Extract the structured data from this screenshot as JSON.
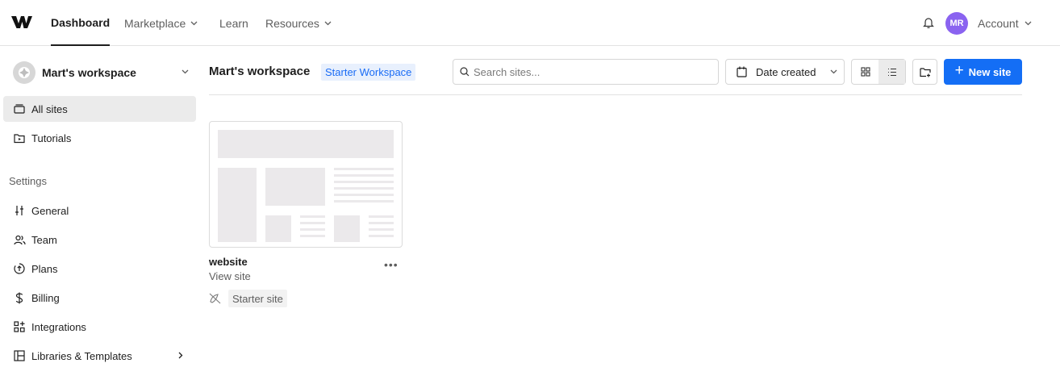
{
  "nav": {
    "items": [
      {
        "label": "Dashboard"
      },
      {
        "label": "Marketplace"
      },
      {
        "label": "Learn"
      },
      {
        "label": "Resources"
      }
    ],
    "avatar_initials": "MR",
    "account_label": "Account"
  },
  "sidebar": {
    "workspace_name": "Mart's workspace",
    "items": [
      {
        "label": "All sites",
        "icon": "folder-icon"
      },
      {
        "label": "Tutorials",
        "icon": "tutorial-icon"
      }
    ],
    "settings_heading": "Settings",
    "settings_items": [
      {
        "label": "General",
        "icon": "sliders-icon"
      },
      {
        "label": "Team",
        "icon": "team-icon"
      },
      {
        "label": "Plans",
        "icon": "plans-icon"
      },
      {
        "label": "Billing",
        "icon": "dollar-icon"
      },
      {
        "label": "Integrations",
        "icon": "integrations-icon"
      },
      {
        "label": "Libraries & Templates",
        "icon": "library-icon"
      }
    ]
  },
  "main": {
    "title": "Mart's workspace",
    "badge": "Starter Workspace",
    "search_placeholder": "Search sites...",
    "sort_label": "Date created",
    "new_site_label": "New site",
    "sites": [
      {
        "name": "website",
        "link_label": "View site",
        "plan_tag": "Starter site"
      }
    ]
  },
  "colors": {
    "accent": "#146ef5",
    "badge_bg": "#e8f0fd",
    "avatar": "#8a63f0"
  }
}
